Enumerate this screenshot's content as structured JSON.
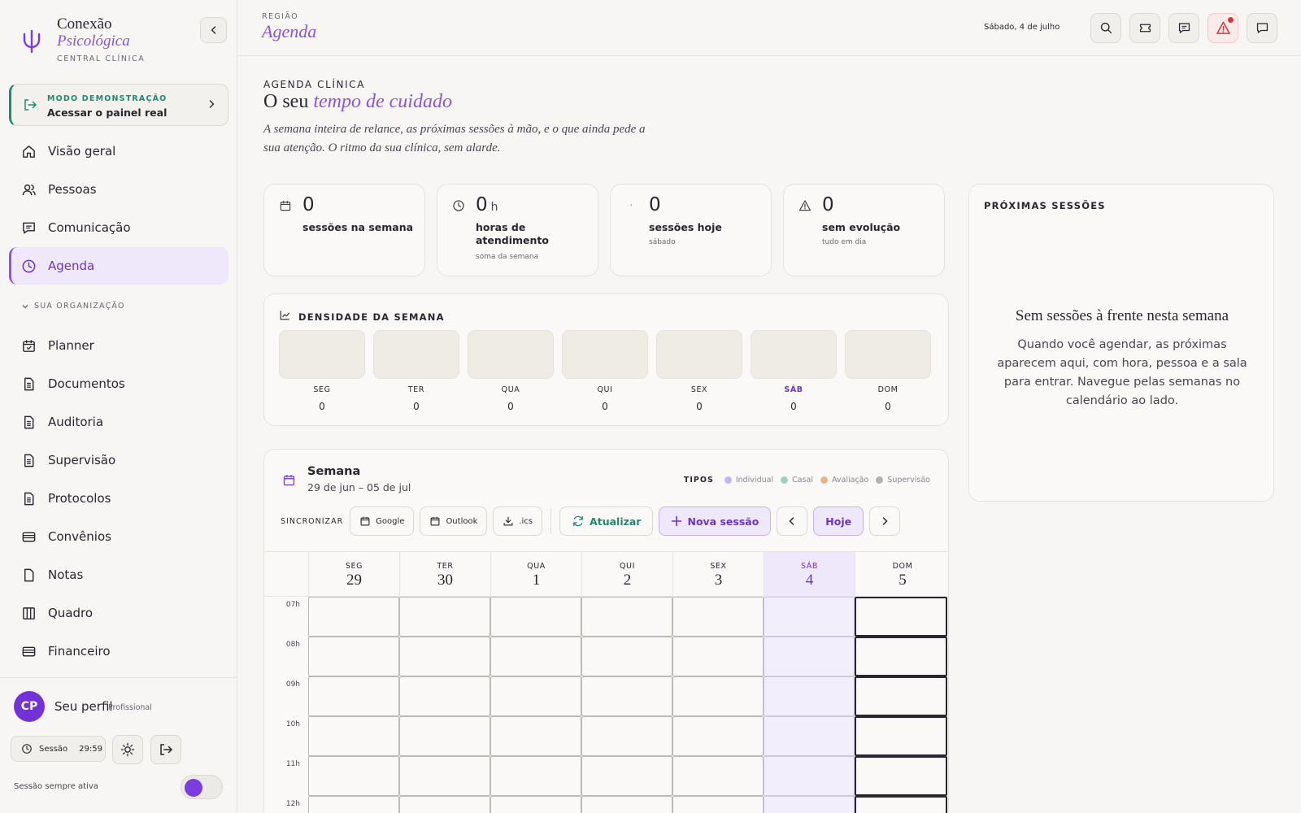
{
  "sidebar": {
    "brand": {
      "name": "Conexão",
      "name_accent": "Psicológica",
      "subtitle": "CENTRAL CLÍNICA"
    },
    "demo": {
      "kicker": "MODO DEMONSTRAÇÃO",
      "label": "Acessar o painel real"
    },
    "nav_main": [
      {
        "label": "Visão geral",
        "icon": "home-icon"
      },
      {
        "label": "Pessoas",
        "icon": "users-icon"
      },
      {
        "label": "Comunicação",
        "icon": "message-icon"
      },
      {
        "label": "Agenda",
        "icon": "clock-icon",
        "active": true
      }
    ],
    "section_label": "SUA ORGANIZAÇÃO",
    "nav_org": [
      {
        "label": "Planner",
        "icon": "calendar-check-icon"
      },
      {
        "label": "Documentos",
        "icon": "document-icon"
      },
      {
        "label": "Auditoria",
        "icon": "document-icon"
      },
      {
        "label": "Supervisão",
        "icon": "document-icon"
      },
      {
        "label": "Protocolos",
        "icon": "document-icon"
      },
      {
        "label": "Convênios",
        "icon": "card-icon"
      },
      {
        "label": "Notas",
        "icon": "file-icon"
      },
      {
        "label": "Quadro",
        "icon": "columns-icon"
      },
      {
        "label": "Financeiro",
        "icon": "card-icon"
      }
    ],
    "profile": {
      "initials": "CP",
      "name": "Seu perfil",
      "role": "Profissional"
    },
    "session": {
      "label": "Sessão",
      "timer": "29:59"
    },
    "always_on_label": "Sessão sempre ativa",
    "always_on": true
  },
  "topbar": {
    "kicker": "REGIÃO",
    "title": "Agenda",
    "date": "Sábado, 4 de julho"
  },
  "page": {
    "kicker": "AGENDA CLÍNICA",
    "title_plain": "O seu",
    "title_accent": "tempo de cuidado",
    "description": "A semana inteira de relance, as próximas sessões à mão, e o que ainda pede a sua atenção. O ritmo da sua clínica, sem alarde."
  },
  "stats": [
    {
      "value": "0",
      "unit": "",
      "label": "sessões na semana",
      "sub": "",
      "icon": "calendar-icon"
    },
    {
      "value": "0",
      "unit": "h",
      "label": "horas de atendimento",
      "sub": "soma da semana",
      "icon": "clock-icon"
    },
    {
      "value": "0",
      "unit": "",
      "label": "sessões hoje",
      "sub": "sábado",
      "icon": "dot-icon"
    },
    {
      "value": "0",
      "unit": "",
      "label": "sem evolução",
      "sub": "tudo em dia",
      "icon": "warning-icon"
    }
  ],
  "density": {
    "title": "DENSIDADE DA SEMANA",
    "days": [
      {
        "day": "SEG",
        "value": "0"
      },
      {
        "day": "TER",
        "value": "0"
      },
      {
        "day": "QUA",
        "value": "0"
      },
      {
        "day": "QUI",
        "value": "0"
      },
      {
        "day": "SEX",
        "value": "0"
      },
      {
        "day": "SÁB",
        "value": "0",
        "today": true
      },
      {
        "day": "DOM",
        "value": "0"
      }
    ]
  },
  "next_sessions": {
    "kicker": "PRÓXIMAS SESSÕES",
    "empty_title": "Sem sessões à frente nesta semana",
    "empty_text": "Quando você agendar, as próximas aparecem aqui, com hora, pessoa e a sala para entrar. Navegue pelas semanas no calendário ao lado."
  },
  "week": {
    "title": "Semana",
    "range": "29 de jun – 05 de jul",
    "types_label": "TIPOS",
    "types": [
      {
        "name": "Individual",
        "color": "#c7b3ef"
      },
      {
        "name": "Casal",
        "color": "#9fd0c0"
      },
      {
        "name": "Avaliação",
        "color": "#e8b48f"
      },
      {
        "name": "Supervisão",
        "color": "#b5b2ad"
      }
    ],
    "sync_label": "SINCRONIZAR",
    "sync_buttons": [
      "Google",
      "Outlook",
      ".ics"
    ],
    "refresh_label": "Atualizar",
    "new_session_label": "Nova sessão",
    "today_label": "Hoje",
    "columns": [
      {
        "day": "SEG",
        "date": "29"
      },
      {
        "day": "TER",
        "date": "30"
      },
      {
        "day": "QUA",
        "date": "1"
      },
      {
        "day": "QUI",
        "date": "2"
      },
      {
        "day": "SEX",
        "date": "3"
      },
      {
        "day": "SÁB",
        "date": "4",
        "today": true
      },
      {
        "day": "DOM",
        "date": "5"
      }
    ],
    "hours": [
      "07h",
      "08h",
      "09h",
      "10h",
      "11h",
      "12h"
    ]
  },
  "colors": {
    "accent": "#8a55d6",
    "accent_dark": "#6d35c4",
    "green": "#1f8a72",
    "alert": "#d23a3a"
  }
}
